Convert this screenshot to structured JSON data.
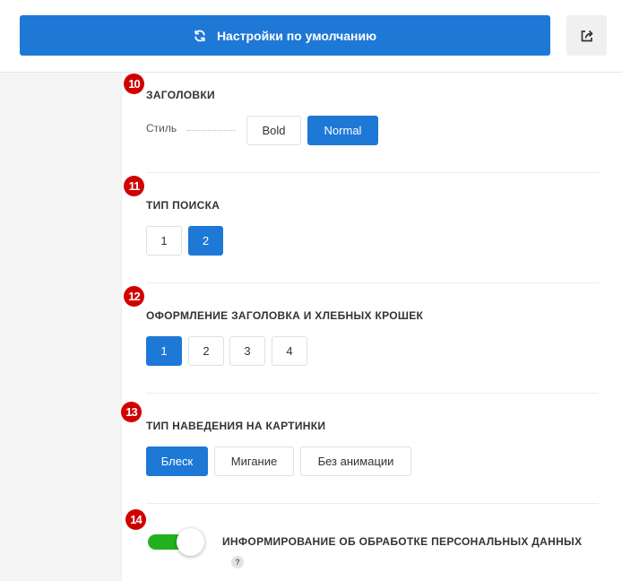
{
  "header": {
    "reset_label": "Настройки по умолчанию"
  },
  "colors": {
    "accent": "#1e78d6",
    "badge": "#d00000",
    "toggle_on": "#22b11e"
  },
  "sections": [
    {
      "number": "10",
      "title": "ЗАГОЛОВКИ",
      "style_label": "Стиль",
      "options": [
        "Bold",
        "Normal"
      ],
      "selected": "Normal"
    },
    {
      "number": "11",
      "title": "ТИП ПОИСКА",
      "options": [
        "1",
        "2"
      ],
      "selected": "2"
    },
    {
      "number": "12",
      "title": "ОФОРМЛЕНИЕ ЗАГОЛОВКА И ХЛЕБНЫХ КРОШЕК",
      "options": [
        "1",
        "2",
        "3",
        "4"
      ],
      "selected": "1"
    },
    {
      "number": "13",
      "title": "ТИП НАВЕДЕНИЯ НА КАРТИНКИ",
      "options": [
        "Блеск",
        "Мигание",
        "Без анимации"
      ],
      "selected": "Блеск"
    },
    {
      "number": "14",
      "title": "ИНФОРМИРОВАНИЕ ОБ ОБРАБОТКЕ ПЕРСОНАЛЬНЫХ ДАННЫХ",
      "toggle_on": true,
      "help": "?"
    }
  ]
}
